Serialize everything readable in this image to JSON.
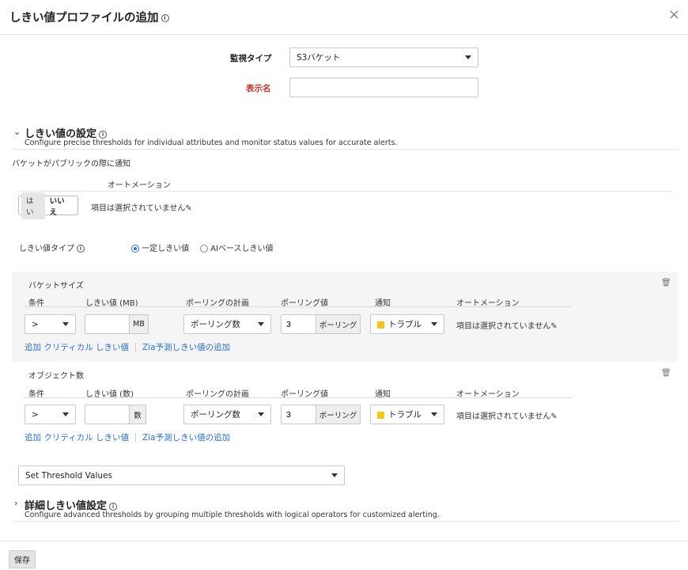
{
  "dialog": {
    "title": "しきい値プロファイルの追加",
    "close_icon": "×"
  },
  "form": {
    "monitor_type_label": "監視タイプ",
    "monitor_type_value": "S3バケット",
    "display_name_label": "表示名",
    "display_name_value": ""
  },
  "threshold_settings": {
    "title": "しきい値の設定",
    "description": "Configure precise thresholds for individual attributes and monitor status values for accurate alerts.",
    "public_notify_label": "バケットがパブリックの際に通知",
    "automation_header": "オートメーション",
    "toggle_yes": "はい",
    "toggle_no": "いいえ",
    "automation_value": "項目は選択されていません",
    "threshold_type_label": "しきい値タイプ",
    "radio_fixed": "一定しきい値",
    "radio_ai": "AIベースしきい値"
  },
  "headers": {
    "condition": "条件",
    "poll_plan": "ポーリングの計画",
    "poll_value": "ポーリング値",
    "notify": "通知",
    "automation": "オートメーション"
  },
  "rules": [
    {
      "name": "バケットサイズ",
      "threshold_header": "しきい値 (MB)",
      "condition": ">",
      "threshold_value": "",
      "unit": "MB",
      "poll_plan": "ポーリング数",
      "poll_value": "3",
      "poll_unit": "ポーリング",
      "notify": "トラブル",
      "automation": "項目は選択されていません",
      "link_add_critical": "追加 クリティカル しきい値",
      "link_zia": "Zia予測しきい値の追加"
    },
    {
      "name": "オブジェクト数",
      "threshold_header": "しきい値 (数)",
      "condition": ">",
      "threshold_value": "",
      "unit": "数",
      "poll_plan": "ポーリング数",
      "poll_value": "3",
      "poll_unit": "ポーリング",
      "notify": "トラブル",
      "automation": "項目は選択されていません",
      "link_add_critical": "追加 クリティカル しきい値",
      "link_zia": "Zia予測しきい値の追加"
    }
  ],
  "set_threshold_select": "Set Threshold Values",
  "advanced": {
    "title": "詳細しきい値設定",
    "description": "Configure advanced thresholds by grouping multiple thresholds with logical operators for customized alerting."
  },
  "footer": {
    "save_label": "保存"
  },
  "colors": {
    "accent": "#2a6fdb",
    "required": "#d0342c",
    "trouble": "#f5c518"
  }
}
